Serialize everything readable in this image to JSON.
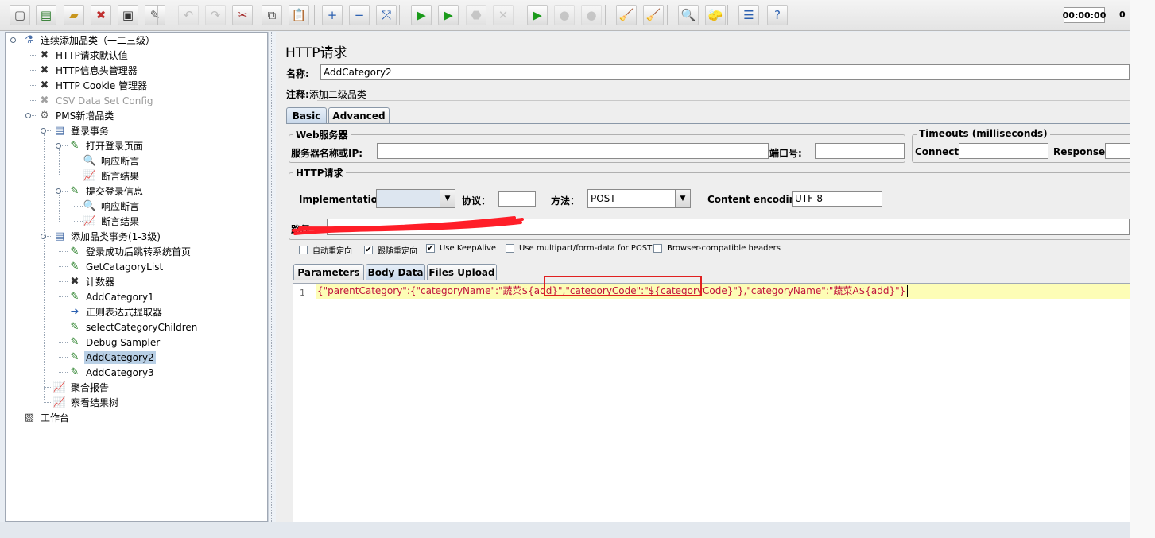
{
  "toolbar": {
    "buttons": [
      {
        "name": "new-icon",
        "glyph": "▢"
      },
      {
        "name": "templates-icon",
        "glyph": "▤"
      },
      {
        "name": "open-icon",
        "glyph": "▰"
      },
      {
        "name": "close-icon",
        "glyph": "✖"
      },
      {
        "name": "save-icon",
        "glyph": "▣"
      },
      {
        "name": "save-as-icon",
        "glyph": "✎"
      },
      {
        "name": "undo-icon",
        "glyph": "↶"
      },
      {
        "name": "redo-icon",
        "glyph": "↷"
      },
      {
        "name": "cut-icon",
        "glyph": "✂"
      },
      {
        "name": "copy-icon",
        "glyph": "⧉"
      },
      {
        "name": "paste-icon",
        "glyph": "📋"
      },
      {
        "name": "expand-icon",
        "glyph": "+"
      },
      {
        "name": "collapse-icon",
        "glyph": "−"
      },
      {
        "name": "toggle-icon",
        "glyph": "⤱"
      },
      {
        "name": "start-icon",
        "glyph": "▶"
      },
      {
        "name": "start-no-pause-icon",
        "glyph": "▶"
      },
      {
        "name": "stop-icon",
        "glyph": "⬣"
      },
      {
        "name": "shutdown-icon",
        "glyph": "✕"
      },
      {
        "name": "remote-start-icon",
        "glyph": "▶"
      },
      {
        "name": "remote-stop-icon",
        "glyph": "●"
      },
      {
        "name": "remote-shutdown-icon",
        "glyph": "●"
      },
      {
        "name": "clear-icon",
        "glyph": "🧹"
      },
      {
        "name": "clear-all-icon",
        "glyph": "🧹"
      },
      {
        "name": "search-icon",
        "glyph": "🔍"
      },
      {
        "name": "reset-search-icon",
        "glyph": "🧽"
      },
      {
        "name": "function-helper-icon",
        "glyph": "☰"
      },
      {
        "name": "help-icon",
        "glyph": "?"
      }
    ],
    "timer": "00:00:00",
    "count": "0"
  },
  "tree": {
    "nodes": [
      {
        "label": "连续添加品类（一二三级）",
        "icon": "flask-icon",
        "glyph": "⚗"
      },
      {
        "label": "HTTP请求默认值",
        "icon": "tools-icon",
        "glyph": "✖"
      },
      {
        "label": "HTTP信息头管理器",
        "icon": "tools-icon",
        "glyph": "✖"
      },
      {
        "label": "HTTP Cookie 管理器",
        "icon": "tools-icon",
        "glyph": "✖"
      },
      {
        "label": "CSV Data Set Config",
        "icon": "tools-icon",
        "glyph": "✖"
      },
      {
        "label": "PMS新增品类",
        "icon": "gear-icon",
        "glyph": "⚙"
      },
      {
        "label": "登录事务",
        "icon": "transaction-icon",
        "glyph": "▤"
      },
      {
        "label": "打开登录页面",
        "icon": "sampler-icon",
        "glyph": "✎"
      },
      {
        "label": "响应断言",
        "icon": "magnifier-icon",
        "glyph": "🔍"
      },
      {
        "label": "断言结果",
        "icon": "graph-icon",
        "glyph": "📈"
      },
      {
        "label": "提交登录信息",
        "icon": "sampler-icon",
        "glyph": "✎"
      },
      {
        "label": "响应断言",
        "icon": "magnifier-icon",
        "glyph": "🔍"
      },
      {
        "label": "断言结果",
        "icon": "graph-icon",
        "glyph": "📈"
      },
      {
        "label": "添加品类事务(1-3级)",
        "icon": "transaction-icon",
        "glyph": "▤"
      },
      {
        "label": "登录成功后跳转系统首页",
        "icon": "sampler-icon",
        "glyph": "✎"
      },
      {
        "label": "GetCatagoryList",
        "icon": "sampler-icon",
        "glyph": "✎"
      },
      {
        "label": "计数器",
        "icon": "tools-icon",
        "glyph": "✖"
      },
      {
        "label": "AddCategory1",
        "icon": "sampler-icon",
        "glyph": "✎"
      },
      {
        "label": "正则表达式提取器",
        "icon": "extractor-icon",
        "glyph": "➜"
      },
      {
        "label": "selectCategoryChildren",
        "icon": "sampler-icon",
        "glyph": "✎"
      },
      {
        "label": "Debug Sampler",
        "icon": "sampler-icon",
        "glyph": "✎"
      },
      {
        "label": "AddCategory2",
        "icon": "sampler-icon",
        "glyph": "✎"
      },
      {
        "label": "AddCategory3",
        "icon": "sampler-icon",
        "glyph": "✎"
      },
      {
        "label": "聚合报告",
        "icon": "graph-icon",
        "glyph": "📈"
      },
      {
        "label": "察看结果树",
        "icon": "graph-icon",
        "glyph": "📈"
      },
      {
        "label": "工作台",
        "icon": "workbench-icon",
        "glyph": "▧"
      }
    ]
  },
  "panel": {
    "title": "HTTP请求",
    "name_label": "名称:",
    "name_value": "AddCategory2",
    "comment_label": "注释:",
    "comment_value": "添加二级品类",
    "tabs": [
      "Basic",
      "Advanced"
    ],
    "web_server": {
      "legend": "Web服务器",
      "server_label": "服务器名称或IP:",
      "server_value": "",
      "port_label": "端口号:",
      "port_value": ""
    },
    "timeouts": {
      "legend": "Timeouts (milliseconds)",
      "connect_label": "Connect:",
      "connect_value": "",
      "response_label": "Response:",
      "response_value": ""
    },
    "http_request": {
      "legend": "HTTP请求",
      "implementation_label": "Implementation:",
      "implementation_value": "",
      "protocol_label": "协议：",
      "protocol_value": "",
      "method_label": "方法：",
      "method_value": "POST",
      "encoding_label": "Content encoding:",
      "encoding_value": "UTF-8",
      "path_label": "路径:",
      "path_value": ""
    },
    "options": [
      {
        "label": "自动重定向",
        "checked": false
      },
      {
        "label": "跟随重定向",
        "checked": true
      },
      {
        "label": "Use KeepAlive",
        "checked": true
      },
      {
        "label": "Use multipart/form-data for POST",
        "checked": false
      },
      {
        "label": "Browser-compatible headers",
        "checked": false
      }
    ],
    "subtabs": [
      "Parameters",
      "Body Data",
      "Files Upload"
    ],
    "body": {
      "line_number": "1",
      "code": "{\"parentCategory\":{\"categoryName\":\"蔬菜${add}\",\"categoryCode\":\"${categoryCode}\"},\"categoryName\":\"蔬菜A${add}\"}"
    }
  }
}
